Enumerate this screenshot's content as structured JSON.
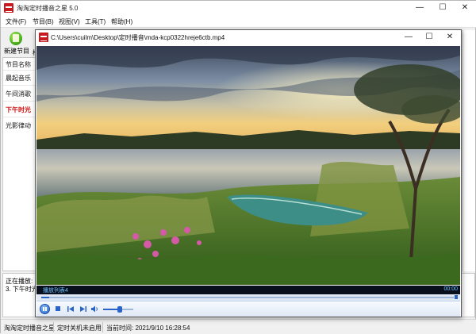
{
  "app": {
    "title": "淘淘定时播音之星 5.0",
    "controls": {
      "minimize": "—",
      "maximize": "☐",
      "close": "✕"
    }
  },
  "menu": [
    "文件(F)",
    "节目(B)",
    "视图(V)",
    "工具(T)",
    "帮助(H)"
  ],
  "toolbar": {
    "new_label": "新建节目",
    "sep_fragment": "横"
  },
  "program_list": {
    "header": "节目名称",
    "items": [
      {
        "label": "晨起音乐",
        "active": false
      },
      {
        "label": "午间消歌",
        "active": false
      },
      {
        "label": "下午时光",
        "active": true
      },
      {
        "label": "光影律动",
        "active": false
      }
    ]
  },
  "now_playing": {
    "line1": "正在播放:",
    "line2": "3. 下午时光"
  },
  "status": {
    "app_name": "淘淘定时播音之星",
    "shutdown": "定时关机未启用",
    "current_time": "当前时间: 2021/9/10 16:28:54"
  },
  "player": {
    "title": "C:\\Users\\cuilm\\Desktop\\定时播音\\mda-kcp0322hreje6ctb.mp4",
    "controls": {
      "minimize": "—",
      "maximize": "☐",
      "close": "✕"
    },
    "track_name": "播放列表4",
    "track_time": "00:00",
    "progress": 0.02,
    "volume": 0.55,
    "icons": [
      "pause-icon",
      "stop-icon",
      "previous-icon",
      "next-icon",
      "volume-icon"
    ],
    "accent": "#2a63c7"
  }
}
